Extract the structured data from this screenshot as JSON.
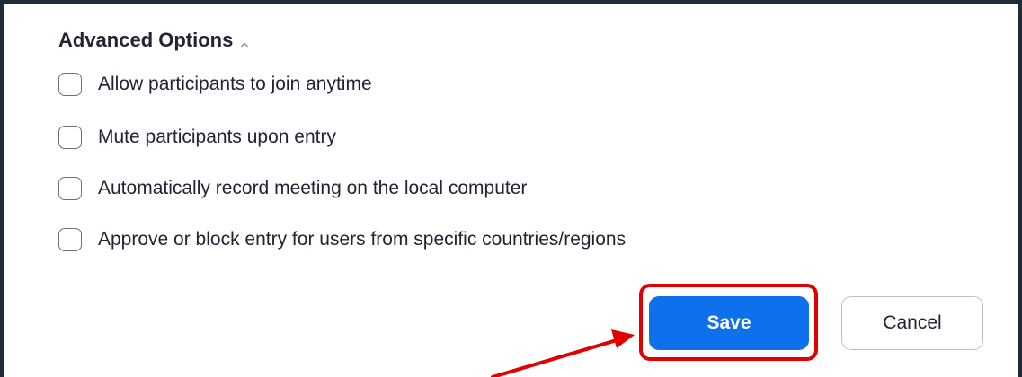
{
  "advanced_options": {
    "title": "Advanced Options",
    "toggle_icon": "chevron-up-icon",
    "options": [
      {
        "label": "Allow participants to join anytime",
        "checked": false
      },
      {
        "label": "Mute participants upon entry",
        "checked": false
      },
      {
        "label": "Automatically record meeting on the local computer",
        "checked": false
      },
      {
        "label": "Approve or block entry for users from specific countries/regions",
        "checked": false
      }
    ]
  },
  "actions": {
    "save_label": "Save",
    "cancel_label": "Cancel"
  },
  "colors": {
    "primary": "#0e71eb",
    "annotation": "#e00000",
    "border": "#1d2b3a"
  }
}
